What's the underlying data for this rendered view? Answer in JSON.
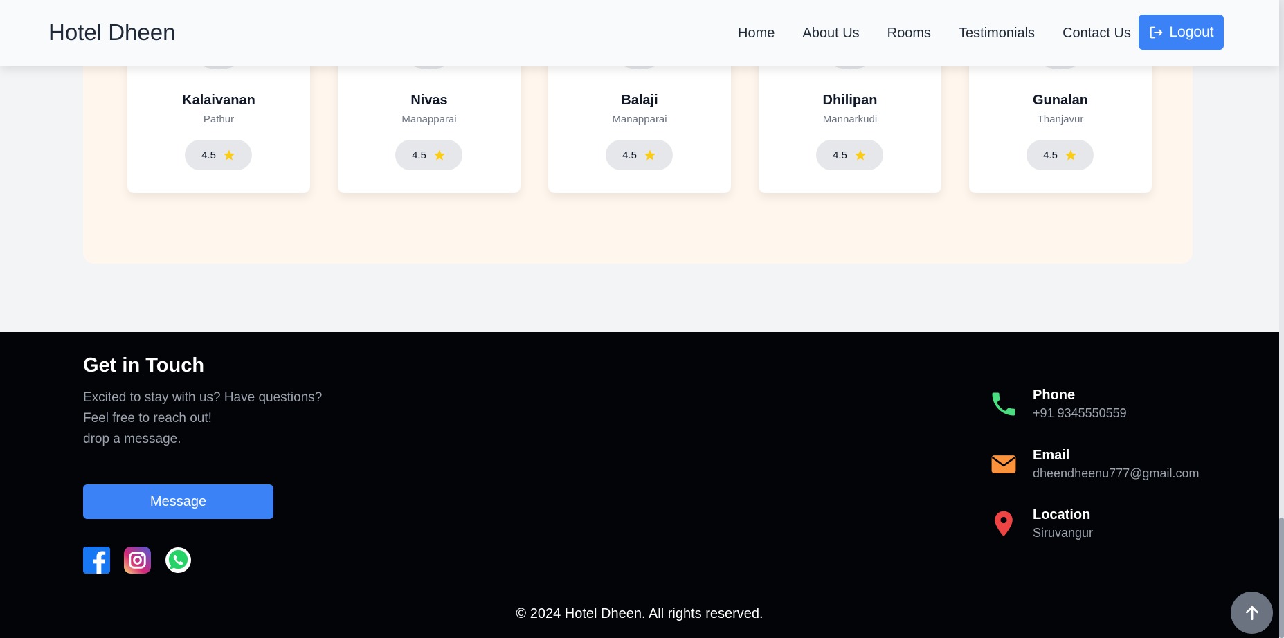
{
  "navbar": {
    "brand": "Hotel Dheen",
    "links": [
      "Home",
      "About Us",
      "Rooms",
      "Testimonials",
      "Contact Us"
    ],
    "logout_label": "Logout"
  },
  "testimonials": [
    {
      "name": "Kalaivanan",
      "location": "Pathur",
      "rating": "4.5"
    },
    {
      "name": "Nivas",
      "location": "Manapparai",
      "rating": "4.5"
    },
    {
      "name": "Balaji",
      "location": "Manapparai",
      "rating": "4.5"
    },
    {
      "name": "Dhilipan",
      "location": "Mannarkudi",
      "rating": "4.5"
    },
    {
      "name": "Gunalan",
      "location": "Thanjavur",
      "rating": "4.5"
    }
  ],
  "footer": {
    "title": "Get in Touch",
    "text_lines": [
      "Excited to stay with us? Have questions?",
      "Feel free to reach out!",
      "drop a message."
    ],
    "message_button": "Message",
    "socials": [
      "facebook-icon",
      "instagram-icon",
      "whatsapp-icon"
    ],
    "contacts": [
      {
        "label": "Phone",
        "value": "+91 9345550559",
        "icon": "phone-icon",
        "color": "#4ade80"
      },
      {
        "label": "Email",
        "value": "dheendheenu777@gmail.com",
        "icon": "email-icon",
        "color": "#fb923c"
      },
      {
        "label": "Location",
        "value": "Siruvangur",
        "icon": "location-pin-icon",
        "color": "#ef4444"
      }
    ],
    "copyright": "© 2024 Hotel Dheen. All rights reserved."
  },
  "colors": {
    "accent": "#3b82f6",
    "star": "#facc15",
    "footer_bg": "#030407"
  }
}
